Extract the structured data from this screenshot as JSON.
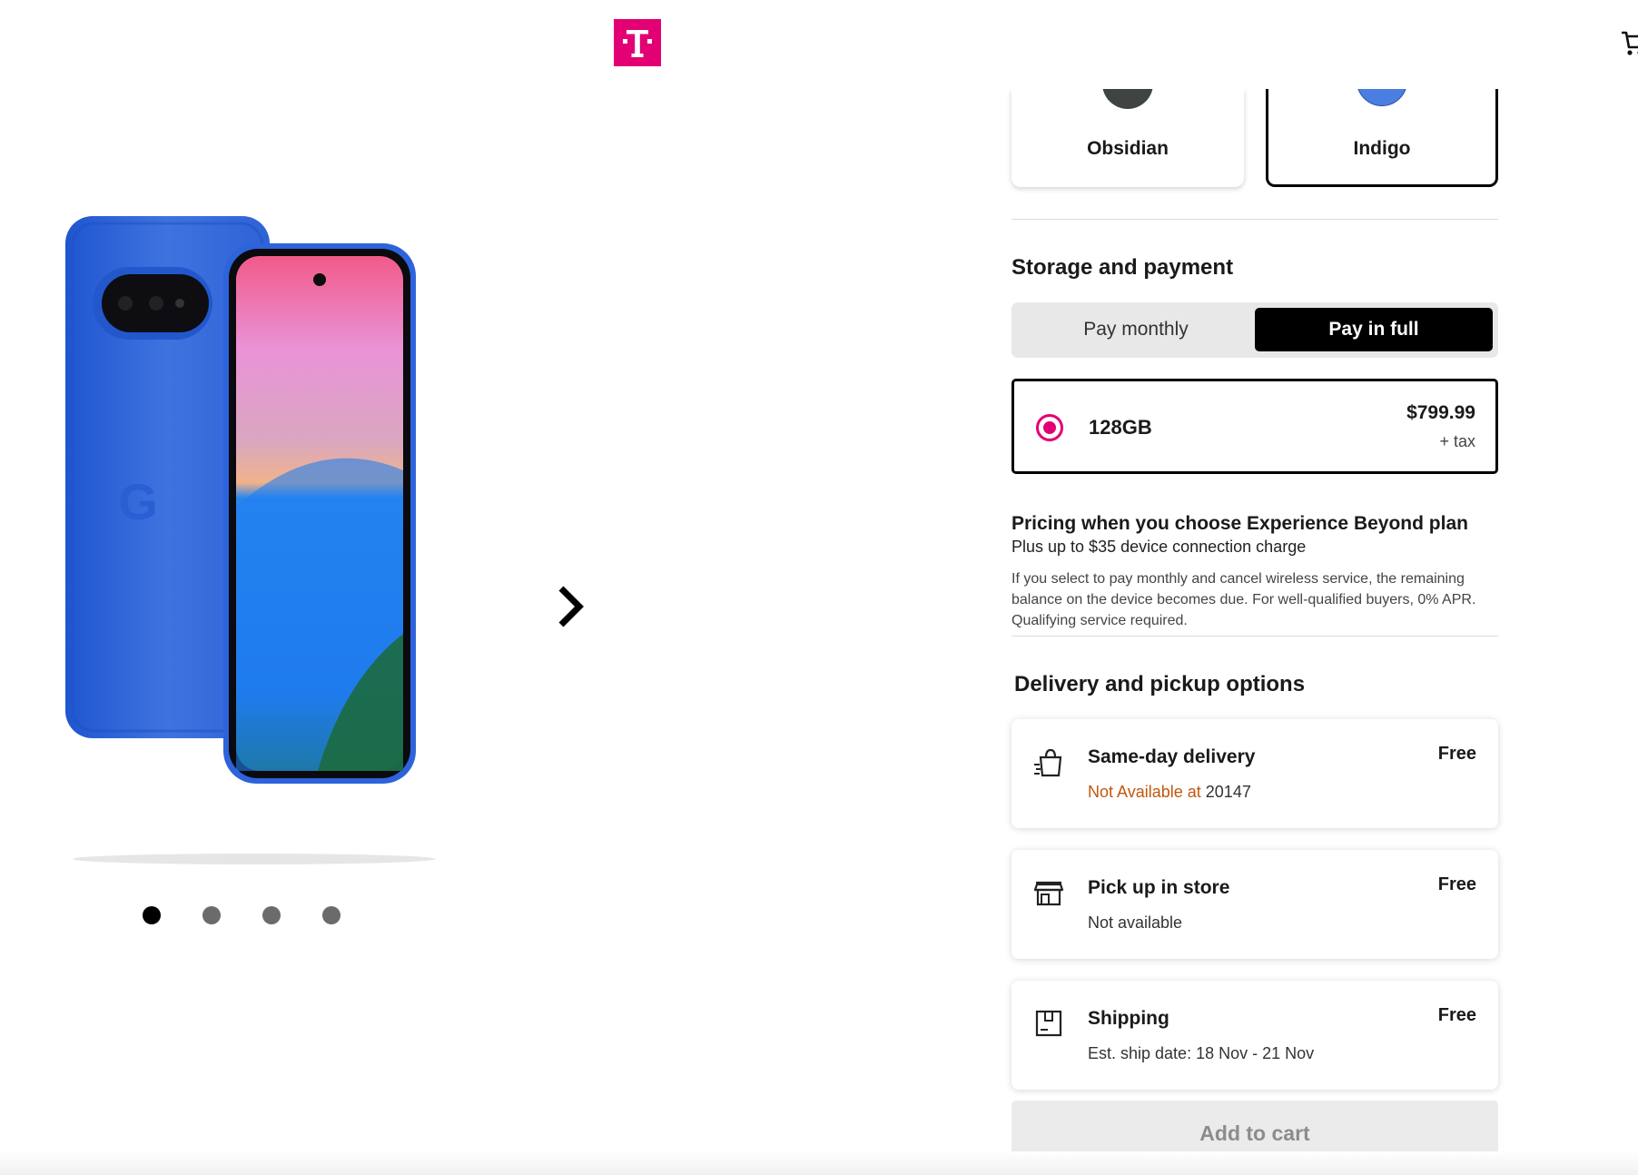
{
  "brand": {
    "logo_letter": "T",
    "color": "#e20074"
  },
  "header": {
    "cart_icon": "cart-icon"
  },
  "gallery": {
    "product_color": "#2f6de0",
    "next_icon": "chevron-right-icon",
    "dot_count": 4,
    "active_dot": 1
  },
  "colors": [
    {
      "name": "Obsidian",
      "swatch": "#3f4442",
      "selected": false
    },
    {
      "name": "Indigo",
      "swatch": "#4a7ee0",
      "selected": true
    }
  ],
  "storage": {
    "title": "Storage and payment",
    "toggle": {
      "monthly": "Pay monthly",
      "full": "Pay in full",
      "selected": "full"
    },
    "option": {
      "capacity": "128GB",
      "price": "$799.99",
      "tax": "+ tax",
      "selected": true
    }
  },
  "plan": {
    "title": "Pricing when you choose Experience Beyond plan",
    "subtitle": "Plus up to $35 device connection charge",
    "note": "If you select to pay monthly and cancel wireless service, the remaining balance on the device becomes due. For well-qualified buyers, 0% APR. Qualifying service required."
  },
  "delivery": {
    "title": "Delivery and pickup options",
    "options": [
      {
        "icon": "shopping-bag-icon",
        "title": "Same-day delivery",
        "status": "Not Available at",
        "zip": "20147",
        "price": "Free"
      },
      {
        "icon": "store-icon",
        "title": "Pick up in store",
        "status": "Not available",
        "price": "Free"
      },
      {
        "icon": "package-icon",
        "title": "Shipping",
        "status": "Est. ship date: 18 Nov - 21 Nov",
        "price": "Free"
      }
    ]
  },
  "cart": {
    "add_label": "Add to cart",
    "enabled": false
  }
}
